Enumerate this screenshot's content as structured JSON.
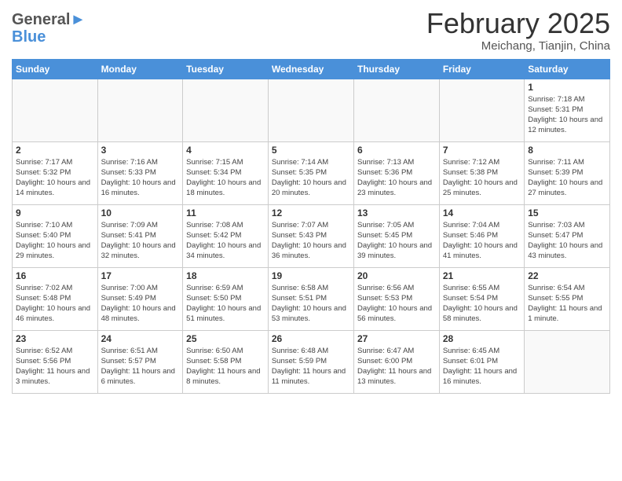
{
  "header": {
    "logo_general": "General",
    "logo_blue": "Blue",
    "month": "February 2025",
    "location": "Meichang, Tianjin, China"
  },
  "days_of_week": [
    "Sunday",
    "Monday",
    "Tuesday",
    "Wednesday",
    "Thursday",
    "Friday",
    "Saturday"
  ],
  "weeks": [
    [
      {
        "day": "",
        "info": ""
      },
      {
        "day": "",
        "info": ""
      },
      {
        "day": "",
        "info": ""
      },
      {
        "day": "",
        "info": ""
      },
      {
        "day": "",
        "info": ""
      },
      {
        "day": "",
        "info": ""
      },
      {
        "day": "1",
        "info": "Sunrise: 7:18 AM\nSunset: 5:31 PM\nDaylight: 10 hours and 12 minutes."
      }
    ],
    [
      {
        "day": "2",
        "info": "Sunrise: 7:17 AM\nSunset: 5:32 PM\nDaylight: 10 hours and 14 minutes."
      },
      {
        "day": "3",
        "info": "Sunrise: 7:16 AM\nSunset: 5:33 PM\nDaylight: 10 hours and 16 minutes."
      },
      {
        "day": "4",
        "info": "Sunrise: 7:15 AM\nSunset: 5:34 PM\nDaylight: 10 hours and 18 minutes."
      },
      {
        "day": "5",
        "info": "Sunrise: 7:14 AM\nSunset: 5:35 PM\nDaylight: 10 hours and 20 minutes."
      },
      {
        "day": "6",
        "info": "Sunrise: 7:13 AM\nSunset: 5:36 PM\nDaylight: 10 hours and 23 minutes."
      },
      {
        "day": "7",
        "info": "Sunrise: 7:12 AM\nSunset: 5:38 PM\nDaylight: 10 hours and 25 minutes."
      },
      {
        "day": "8",
        "info": "Sunrise: 7:11 AM\nSunset: 5:39 PM\nDaylight: 10 hours and 27 minutes."
      }
    ],
    [
      {
        "day": "9",
        "info": "Sunrise: 7:10 AM\nSunset: 5:40 PM\nDaylight: 10 hours and 29 minutes."
      },
      {
        "day": "10",
        "info": "Sunrise: 7:09 AM\nSunset: 5:41 PM\nDaylight: 10 hours and 32 minutes."
      },
      {
        "day": "11",
        "info": "Sunrise: 7:08 AM\nSunset: 5:42 PM\nDaylight: 10 hours and 34 minutes."
      },
      {
        "day": "12",
        "info": "Sunrise: 7:07 AM\nSunset: 5:43 PM\nDaylight: 10 hours and 36 minutes."
      },
      {
        "day": "13",
        "info": "Sunrise: 7:05 AM\nSunset: 5:45 PM\nDaylight: 10 hours and 39 minutes."
      },
      {
        "day": "14",
        "info": "Sunrise: 7:04 AM\nSunset: 5:46 PM\nDaylight: 10 hours and 41 minutes."
      },
      {
        "day": "15",
        "info": "Sunrise: 7:03 AM\nSunset: 5:47 PM\nDaylight: 10 hours and 43 minutes."
      }
    ],
    [
      {
        "day": "16",
        "info": "Sunrise: 7:02 AM\nSunset: 5:48 PM\nDaylight: 10 hours and 46 minutes."
      },
      {
        "day": "17",
        "info": "Sunrise: 7:00 AM\nSunset: 5:49 PM\nDaylight: 10 hours and 48 minutes."
      },
      {
        "day": "18",
        "info": "Sunrise: 6:59 AM\nSunset: 5:50 PM\nDaylight: 10 hours and 51 minutes."
      },
      {
        "day": "19",
        "info": "Sunrise: 6:58 AM\nSunset: 5:51 PM\nDaylight: 10 hours and 53 minutes."
      },
      {
        "day": "20",
        "info": "Sunrise: 6:56 AM\nSunset: 5:53 PM\nDaylight: 10 hours and 56 minutes."
      },
      {
        "day": "21",
        "info": "Sunrise: 6:55 AM\nSunset: 5:54 PM\nDaylight: 10 hours and 58 minutes."
      },
      {
        "day": "22",
        "info": "Sunrise: 6:54 AM\nSunset: 5:55 PM\nDaylight: 11 hours and 1 minute."
      }
    ],
    [
      {
        "day": "23",
        "info": "Sunrise: 6:52 AM\nSunset: 5:56 PM\nDaylight: 11 hours and 3 minutes."
      },
      {
        "day": "24",
        "info": "Sunrise: 6:51 AM\nSunset: 5:57 PM\nDaylight: 11 hours and 6 minutes."
      },
      {
        "day": "25",
        "info": "Sunrise: 6:50 AM\nSunset: 5:58 PM\nDaylight: 11 hours and 8 minutes."
      },
      {
        "day": "26",
        "info": "Sunrise: 6:48 AM\nSunset: 5:59 PM\nDaylight: 11 hours and 11 minutes."
      },
      {
        "day": "27",
        "info": "Sunrise: 6:47 AM\nSunset: 6:00 PM\nDaylight: 11 hours and 13 minutes."
      },
      {
        "day": "28",
        "info": "Sunrise: 6:45 AM\nSunset: 6:01 PM\nDaylight: 11 hours and 16 minutes."
      },
      {
        "day": "",
        "info": ""
      }
    ]
  ]
}
